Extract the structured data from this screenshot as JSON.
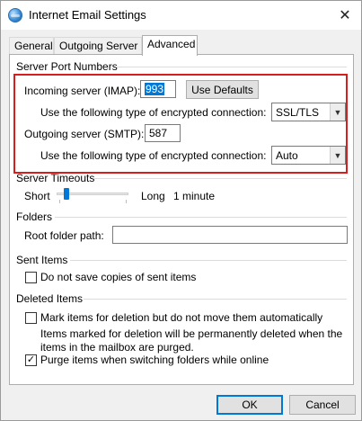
{
  "window": {
    "title": "Internet Email Settings",
    "close_icon": "close-icon",
    "app_icon": "globe-icon"
  },
  "tabs": [
    {
      "label": "General",
      "active": false
    },
    {
      "label": "Outgoing Server",
      "active": false
    },
    {
      "label": "Advanced",
      "active": true
    }
  ],
  "server_ports": {
    "group_label": "Server Port Numbers",
    "incoming_label": "Incoming server (IMAP):",
    "incoming_value": "993",
    "use_defaults_label": "Use Defaults",
    "incoming_encryption_label": "Use the following type of encrypted connection:",
    "incoming_encryption_value": "SSL/TLS",
    "outgoing_label": "Outgoing server (SMTP):",
    "outgoing_value": "587",
    "outgoing_encryption_label": "Use the following type of encrypted connection:",
    "outgoing_encryption_value": "Auto",
    "highlight_color": "#d51f1f"
  },
  "server_timeouts": {
    "group_label": "Server Timeouts",
    "short_label": "Short",
    "long_label": "Long",
    "value_text": "1 minute"
  },
  "folders": {
    "group_label": "Folders",
    "root_folder_label": "Root folder path:",
    "root_folder_value": ""
  },
  "sent_items": {
    "group_label": "Sent Items",
    "do_not_save_label": "Do not save copies of sent items",
    "do_not_save_checked": false
  },
  "deleted_items": {
    "group_label": "Deleted Items",
    "mark_label": "Mark items for deletion but do not move them automatically",
    "mark_checked": false,
    "note": "Items marked for deletion will be permanently deleted when the items in the mailbox are purged.",
    "purge_label": "Purge items when switching folders while online",
    "purge_checked": true,
    "check_glyph": "✓"
  },
  "footer": {
    "ok_label": "OK",
    "cancel_label": "Cancel"
  }
}
